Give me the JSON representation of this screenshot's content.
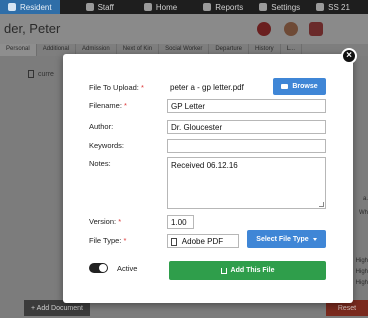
{
  "topnav": {
    "items": [
      {
        "label": "Resident",
        "icon": "user-icon",
        "active": true
      },
      {
        "label": "Staff",
        "icon": "staff-icon"
      },
      {
        "label": "Home",
        "icon": "home-icon"
      },
      {
        "label": "Reports",
        "icon": "reports-icon"
      },
      {
        "label": "Settings",
        "icon": "gear-icon"
      },
      {
        "label": "SS 21",
        "icon": "clock-icon"
      }
    ]
  },
  "header": {
    "resident_name": "der, Peter"
  },
  "tabs": [
    "Personal",
    "Additional",
    "Admission",
    "Next of Kin",
    "Social Worker",
    "Departure",
    "History",
    "L..."
  ],
  "background": {
    "doc_row_label": "curre",
    "side_labels": [
      "a.",
      "Wh",
      "High",
      "High",
      "High"
    ],
    "add_document_label": "+ Add Document",
    "reset_label": "Reset"
  },
  "modal": {
    "close_symbol": "×",
    "file_to_upload_label": "File To Upload:",
    "file_to_upload_value": "peter a - gp letter.pdf",
    "browse_label": "Browse",
    "filename_label": "Filename:",
    "filename_value": "GP Letter",
    "author_label": "Author:",
    "author_value": "Dr. Gloucester",
    "keywords_label": "Keywords:",
    "keywords_value": "",
    "notes_label": "Notes:",
    "notes_value": "Received 06.12.16",
    "version_label": "Version:",
    "version_value": "1.00",
    "file_type_label": "File Type:",
    "file_type_value": "Adobe PDF",
    "select_file_type_label": "Select File Type",
    "active_label": "Active",
    "active_on": true,
    "add_file_label": "Add This File",
    "required_mark": "*"
  },
  "colors": {
    "primary_blue": "#3f86d6",
    "success_green": "#2f9e4b",
    "required_red": "#dd3333",
    "overlay_grey": "#7a7a7a"
  }
}
